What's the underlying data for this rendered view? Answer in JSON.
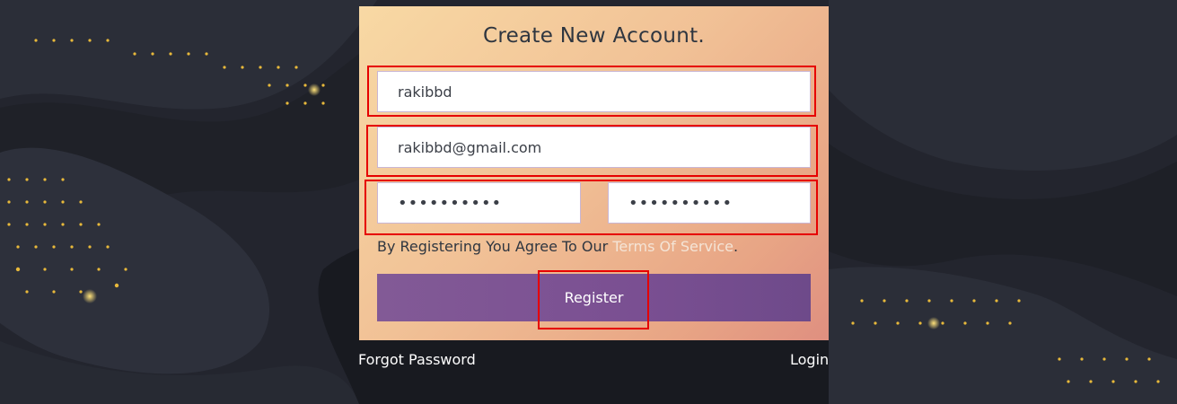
{
  "form": {
    "title": "Create New Account.",
    "username": "rakibbd",
    "email": "rakibbd@gmail.com",
    "password": "••••••••••",
    "confirm_password": "••••••••••",
    "agree_prefix": "By Registering You Agree To Our",
    "terms_link": "Terms Of Service",
    "agree_suffix": ".",
    "register_label": "Register"
  },
  "links": {
    "forgot_password": "Forgot Password",
    "login": "Login"
  },
  "colors": {
    "background": "#23252e",
    "accent_purple": "#7a4f92",
    "highlight_red": "#e60000"
  }
}
